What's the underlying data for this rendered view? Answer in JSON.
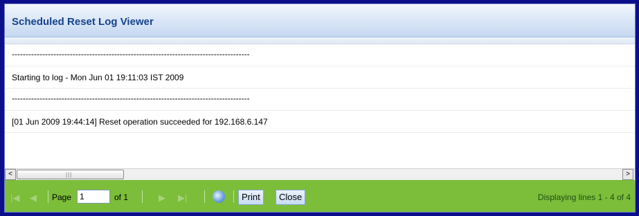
{
  "window": {
    "title": "Scheduled Reset Log Viewer"
  },
  "log_lines": [
    "--------------------------------------------------------------------------------------",
    "Starting to log - Mon Jun 01 19:11:03 IST 2009",
    "--------------------------------------------------------------------------------------",
    "[01 Jun 2009 19:44:14] Reset operation succeeded for 192.168.6.147"
  ],
  "scrollbar": {
    "left_arrow": "<",
    "right_arrow": ">",
    "grip": "|||"
  },
  "paging": {
    "first_icon": "|◀",
    "prev_icon": "◀",
    "next_icon": "▶",
    "last_icon": "▶|",
    "page_label": "Page",
    "page_value": "1",
    "of_label": "of 1",
    "print_label": "Print",
    "close_label": "Close",
    "status_text": "Displaying lines 1 - 4 of 4"
  },
  "colors": {
    "background": "#0c0f8c",
    "title_text": "#15428b",
    "toolbar": "#7cbd3a"
  }
}
